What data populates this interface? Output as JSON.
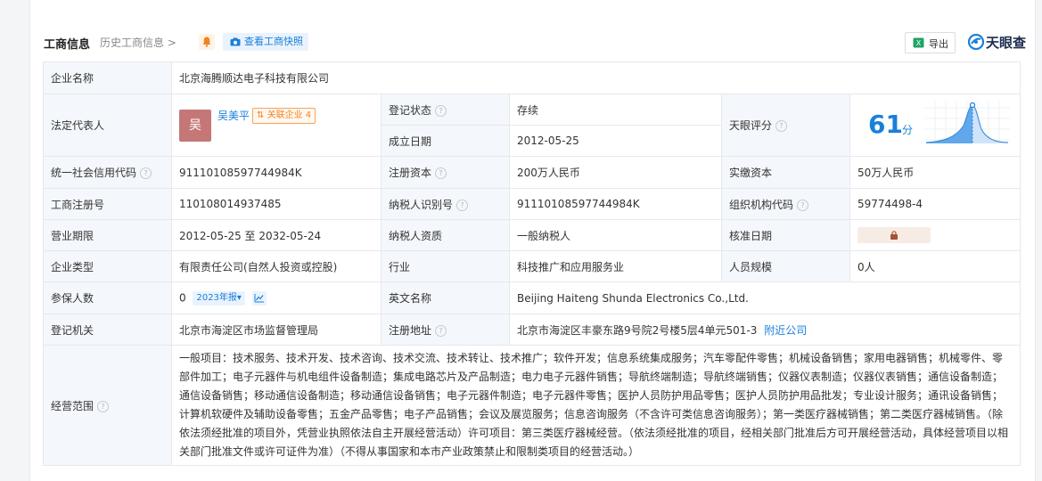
{
  "header": {
    "title": "工商信息",
    "history_link": "历史工商信息 >",
    "snapshot_button": "查看工商快照",
    "export_button": "导出",
    "brand": "天眼查"
  },
  "company": {
    "name_label": "企业名称",
    "name": "北京海腾顺达电子科技有限公司",
    "legal_rep_label": "法定代表人",
    "legal_rep_avatar": "吴",
    "legal_rep_name": "吴美平",
    "related_badge": "关联企业 4",
    "reg_status_label": "登记状态",
    "reg_status": "存续",
    "founded_label": "成立日期",
    "founded": "2012-05-25",
    "score_label": "天眼评分",
    "score_value": "61",
    "score_unit": "分",
    "score_fraction": 0.61,
    "credit_code_label": "统一社会信用代码",
    "credit_code": "91110108597744984K",
    "reg_capital_label": "注册资本",
    "reg_capital": "200万人民币",
    "paid_capital_label": "实缴资本",
    "paid_capital": "50万人民币",
    "reg_no_label": "工商注册号",
    "reg_no": "110108014937485",
    "taxpayer_id_label": "纳税人识别号",
    "taxpayer_id": "91110108597744984K",
    "org_code_label": "组织机构代码",
    "org_code": "59774498-4",
    "term_label": "营业期限",
    "term": "2012-05-25 至 2032-05-24",
    "taxpayer_qual_label": "纳税人资质",
    "taxpayer_qual": "一般纳税人",
    "approve_date_label": "核准日期",
    "type_label": "企业类型",
    "type": "有限责任公司(自然人投资或控股)",
    "industry_label": "行业",
    "industry": "科技推广和应用服务业",
    "staff_label": "人员规模",
    "staff": "0人",
    "insured_label": "参保人数",
    "insured": "0",
    "report_badge": "2023年报",
    "english_name_label": "英文名称",
    "english_name": "Beijing Haiteng Shunda Electronics Co.,Ltd.",
    "authority_label": "登记机关",
    "authority": "北京市海淀区市场监督管理局",
    "address_label": "注册地址",
    "address": "北京市海淀区丰豪东路9号院2号楼5层4单元501-3",
    "nearby_link": "附近公司",
    "scope_label": "经营范围",
    "scope": "一般项目：技术服务、技术开发、技术咨询、技术交流、技术转让、技术推广；软件开发；信息系统集成服务；汽车零配件零售；机械设备销售；家用电器销售；机械零件、零部件加工；电子元器件与机电组件设备制造；集成电路芯片及产品制造；电力电子元器件销售；导航终端制造；导航终端销售；仪器仪表制造；仪器仪表销售；通信设备制造；通信设备销售；移动通信设备制造；移动通信设备销售；电子元器件制造；电子元器件零售；医护人员防护用品零售；医护人员防护用品批发；专业设计服务；通讯设备销售；计算机软硬件及辅助设备零售；五金产品零售；电子产品销售；会议及展览服务；信息咨询服务（不含许可类信息咨询服务）；第一类医疗器械销售；第二类医疗器械销售。（除依法须经批准的项目外，凭营业执照依法自主开展经营活动）许可项目：第三类医疗器械经营。（依法须经批准的项目，经相关部门批准后方可开展经营活动，具体经营项目以相关部门批准文件或许可证件为准）（不得从事国家和本市产业政策禁止和限制类项目的经营活动。）"
  },
  "colors": {
    "accent": "#1a7fd9",
    "status_green": "#20a162",
    "label_bg": "#f4f7fb",
    "avatar_bg": "#c57778"
  }
}
